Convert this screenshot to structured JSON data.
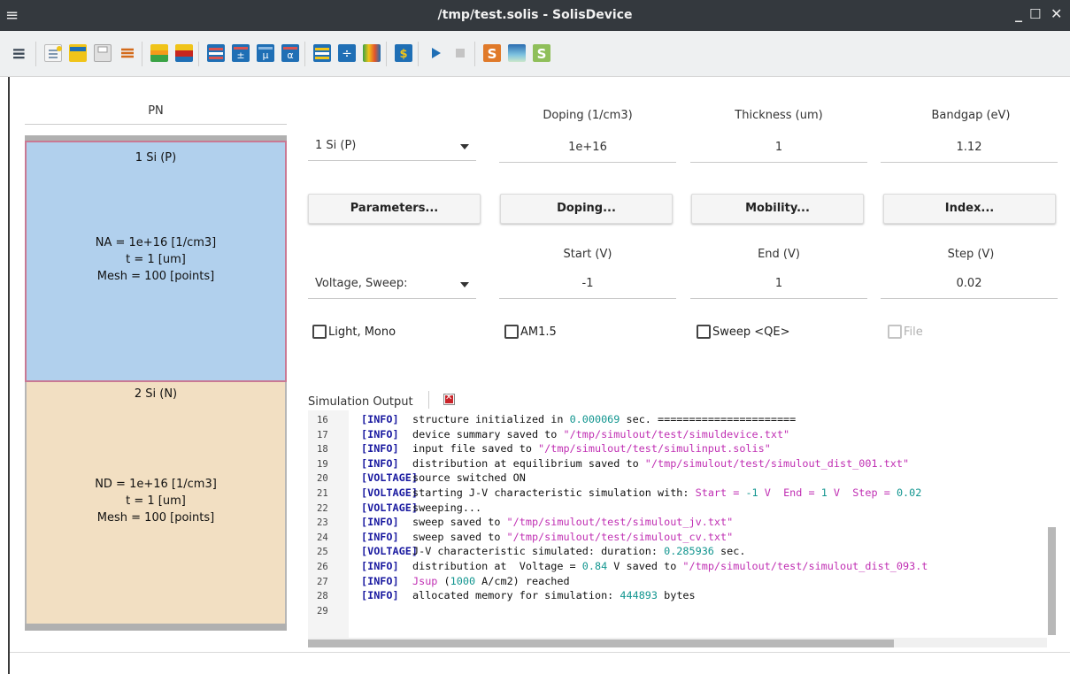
{
  "window": {
    "title": "/tmp/test.solis - SolisDevice",
    "menu_icon": "≡",
    "minimize": "_",
    "maximize": "☐",
    "close": "✕"
  },
  "toolbar": {
    "menu_icon": "≡",
    "icons": [
      "new-icon",
      "open-icon",
      "save-icon",
      "list-icon",
      "layer-green-icon",
      "layer-red-icon",
      "parameters-icon",
      "doping-icon",
      "mobility-icon",
      "index-icon",
      "layer-props-icon",
      "divide-icon",
      "spectrum-icon",
      "dollar-icon",
      "run-icon",
      "stop-icon",
      "solis-icon",
      "gradient-icon",
      "solis-green-icon"
    ]
  },
  "structure": {
    "title": "PN",
    "layers": [
      {
        "name": "1 Si (P)",
        "info": [
          "NA = 1e+16  [1/cm3]",
          "t = 1  [um]",
          "Mesh = 100  [points]"
        ],
        "color": "#b1d0ed"
      },
      {
        "name": "2 Si (N)",
        "info": [
          "ND = 1e+16  [1/cm3]",
          "t = 1  [um]",
          "Mesh = 100  [points]"
        ],
        "color": "#f2dfc2"
      }
    ]
  },
  "layer_form": {
    "selected_layer": "1 Si (P)",
    "headers": {
      "doping": "Doping (1/cm3)",
      "thickness": "Thickness (um)",
      "bandgap": "Bandgap (eV)"
    },
    "values": {
      "doping": "1e+16",
      "thickness": "1",
      "bandgap": "1.12"
    }
  },
  "buttons": {
    "parameters": "Parameters...",
    "doping": "Doping...",
    "mobility": "Mobility...",
    "index": "Index..."
  },
  "sweep_form": {
    "mode": "Voltage, Sweep:",
    "headers": {
      "start": "Start (V)",
      "end": "End (V)",
      "step": "Step (V)"
    },
    "values": {
      "start": "-1",
      "end": "1",
      "step": "0.02"
    }
  },
  "checkboxes": {
    "light_mono": "Light, Mono",
    "am15": "AM1.5",
    "sweep_qe": "Sweep <QE>",
    "file": "File"
  },
  "output": {
    "label": "Simulation Output",
    "lines": [
      {
        "n": "16",
        "tag": "[INFO]",
        "parts": [
          [
            "t",
            "structure initialized in "
          ],
          [
            "num",
            "0.000069"
          ],
          [
            "t",
            " sec. ======================"
          ]
        ]
      },
      {
        "n": "17",
        "tag": "[INFO]",
        "parts": [
          [
            "t",
            "device summary saved to "
          ],
          [
            "str",
            "\"/tmp/simulout/test/simuldevice.txt\""
          ]
        ]
      },
      {
        "n": "18",
        "tag": "[INFO]",
        "parts": [
          [
            "t",
            "input file saved to "
          ],
          [
            "str",
            "\"/tmp/simulout/test/simulinput.solis\""
          ]
        ]
      },
      {
        "n": "19",
        "tag": "[INFO]",
        "parts": [
          [
            "t",
            "distribution at equilibrium saved to "
          ],
          [
            "str",
            "\"/tmp/simulout/test/simulout_dist_001.txt\""
          ]
        ]
      },
      {
        "n": "20",
        "tag": "[VOLTAGE]",
        "parts": [
          [
            "t",
            "source switched ON"
          ]
        ]
      },
      {
        "n": "21",
        "tag": "[VOLTAGE]",
        "parts": [
          [
            "t",
            "starting J-V characteristic simulation with: "
          ],
          [
            "str",
            "Start = "
          ],
          [
            "num",
            "-1"
          ],
          [
            "str",
            " V  End = "
          ],
          [
            "num",
            "1"
          ],
          [
            "str",
            " V  Step = "
          ],
          [
            "num",
            "0.02"
          ]
        ]
      },
      {
        "n": "22",
        "tag": "[VOLTAGE]",
        "parts": [
          [
            "t",
            "sweeping..."
          ]
        ]
      },
      {
        "n": "23",
        "tag": "[INFO]",
        "parts": [
          [
            "t",
            "sweep saved to "
          ],
          [
            "str",
            "\"/tmp/simulout/test/simulout_jv.txt\""
          ]
        ]
      },
      {
        "n": "24",
        "tag": "[INFO]",
        "parts": [
          [
            "t",
            "sweep saved to "
          ],
          [
            "str",
            "\"/tmp/simulout/test/simulout_cv.txt\""
          ]
        ]
      },
      {
        "n": "25",
        "tag": "[VOLTAGE]",
        "parts": [
          [
            "t",
            "J-V characteristic simulated: duration: "
          ],
          [
            "num",
            "0.285936"
          ],
          [
            "t",
            " sec."
          ]
        ]
      },
      {
        "n": "26",
        "tag": "[INFO]",
        "parts": [
          [
            "t",
            "distribution at  Voltage = "
          ],
          [
            "num",
            "0.84"
          ],
          [
            "t",
            " V saved to "
          ],
          [
            "str",
            "\"/tmp/simulout/test/simulout_dist_093.t"
          ]
        ]
      },
      {
        "n": "27",
        "tag": "[INFO]",
        "parts": [
          [
            "str",
            "Jsup"
          ],
          [
            "t",
            " ("
          ],
          [
            "num",
            "1000"
          ],
          [
            "t",
            " A/cm2) reached"
          ]
        ]
      },
      {
        "n": "28",
        "tag": "[INFO]",
        "parts": [
          [
            "t",
            "allocated memory for simulation: "
          ],
          [
            "num",
            "444893"
          ],
          [
            "t",
            " bytes"
          ]
        ]
      },
      {
        "n": "29",
        "tag": "",
        "parts": []
      }
    ]
  }
}
